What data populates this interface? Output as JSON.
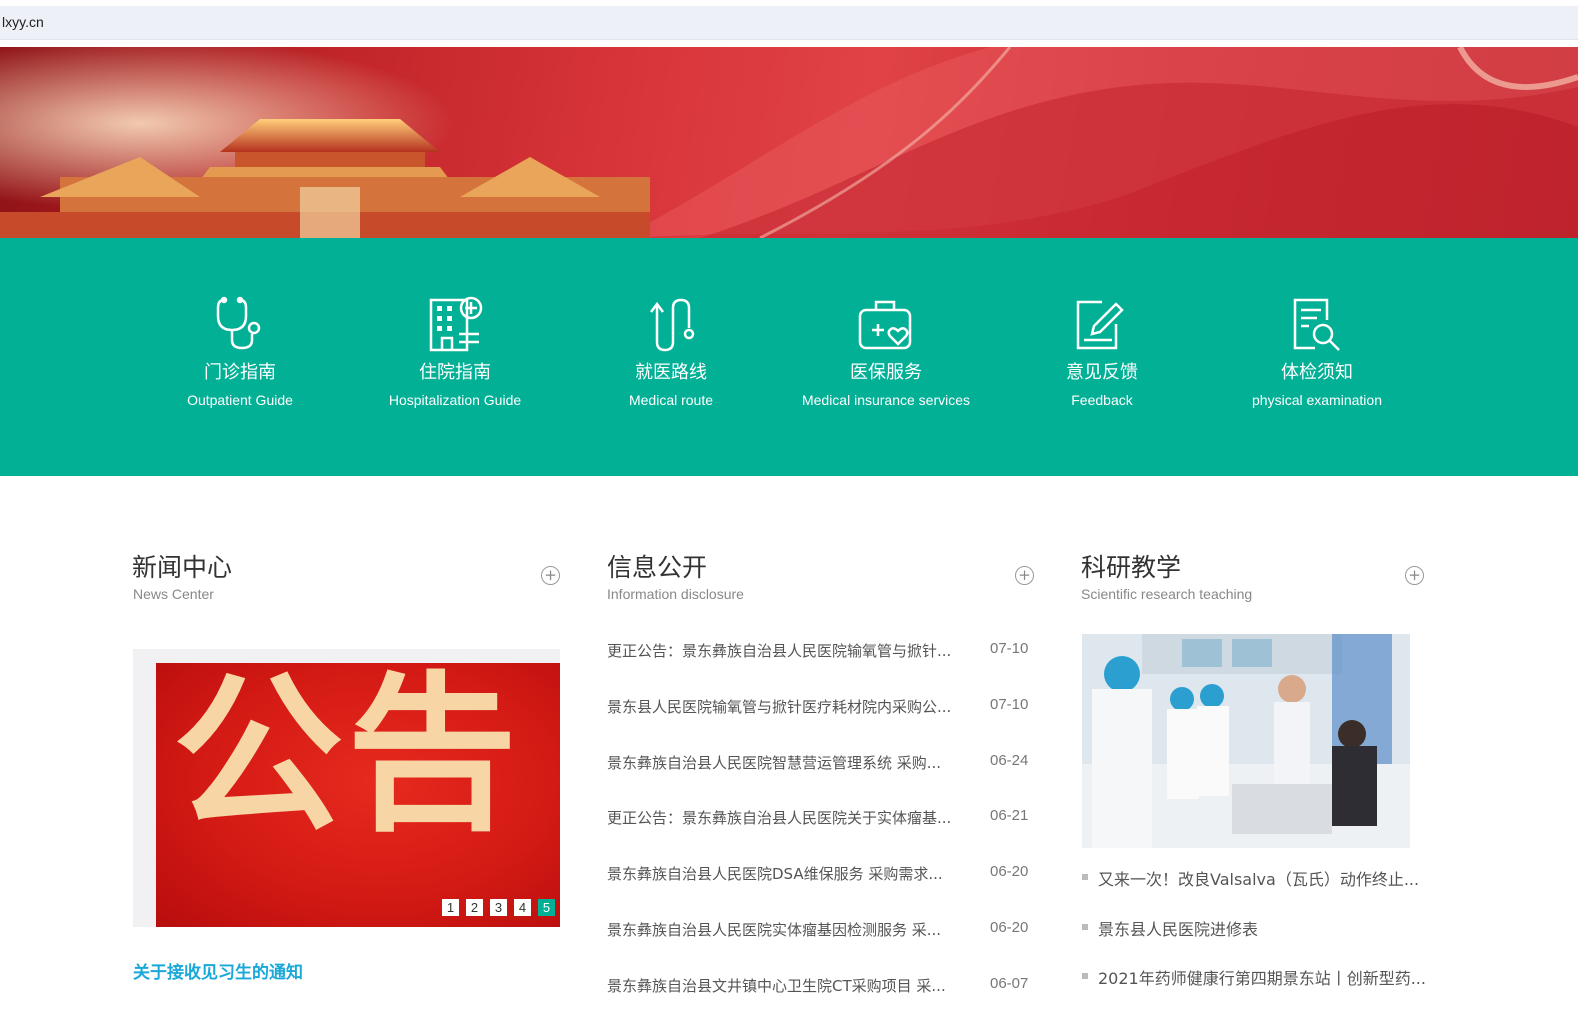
{
  "browser": {
    "url": "lxyy.cn"
  },
  "banner": {
    "slides": 4,
    "active_slide": 4
  },
  "quicknav": [
    {
      "cn": "门诊指南",
      "en": "Outpatient Guide",
      "icon": "stethoscope-icon"
    },
    {
      "cn": "住院指南",
      "en": "Hospitalization Guide",
      "icon": "hospital-building-icon"
    },
    {
      "cn": "就医路线",
      "en": "Medical route",
      "icon": "route-icon"
    },
    {
      "cn": "医保服务",
      "en": "Medical insurance services",
      "icon": "medical-kit-icon"
    },
    {
      "cn": "意见反馈",
      "en": "Feedback",
      "icon": "feedback-edit-icon"
    },
    {
      "cn": "体检须知",
      "en": "physical examination",
      "icon": "document-search-icon"
    }
  ],
  "news": {
    "title": "新闻中心",
    "subtitle": "News Center",
    "image_text": "公告",
    "pages": [
      "1",
      "2",
      "3",
      "4",
      "5"
    ],
    "active_page": "5",
    "headline": "关于接收见习生的通知"
  },
  "info": {
    "title": "信息公开",
    "subtitle": "Information disclosure",
    "items": [
      {
        "text": "更正公告：景东彝族自治县人民医院输氧管与掀针...",
        "date": "07-10"
      },
      {
        "text": "景东县人民医院输氧管与掀针医疗耗材院内采购公...",
        "date": "07-10"
      },
      {
        "text": "景东彝族自治县人民医院智慧营运管理系统 采购...",
        "date": "06-24"
      },
      {
        "text": "更正公告：景东彝族自治县人民医院关于实体瘤基...",
        "date": "06-21"
      },
      {
        "text": "景东彝族自治县人民医院DSA维保服务 采购需求...",
        "date": "06-20"
      },
      {
        "text": "景东彝族自治县人民医院实体瘤基因检测服务 采...",
        "date": "06-20"
      },
      {
        "text": "景东彝族自治县文井镇中心卫生院CT采购项目 采...",
        "date": "06-07"
      }
    ]
  },
  "research": {
    "title": "科研教学",
    "subtitle": "Scientific research teaching",
    "items": [
      "又来一次！改良Valsalva（瓦氏）动作终止...",
      "景东县人民医院进修表",
      "2021年药师健康行第四期景东站丨创新型药..."
    ]
  },
  "colors": {
    "accent_green": "#02b096",
    "banner_red": "#d8353a",
    "link_blue": "#1aa8d8"
  }
}
